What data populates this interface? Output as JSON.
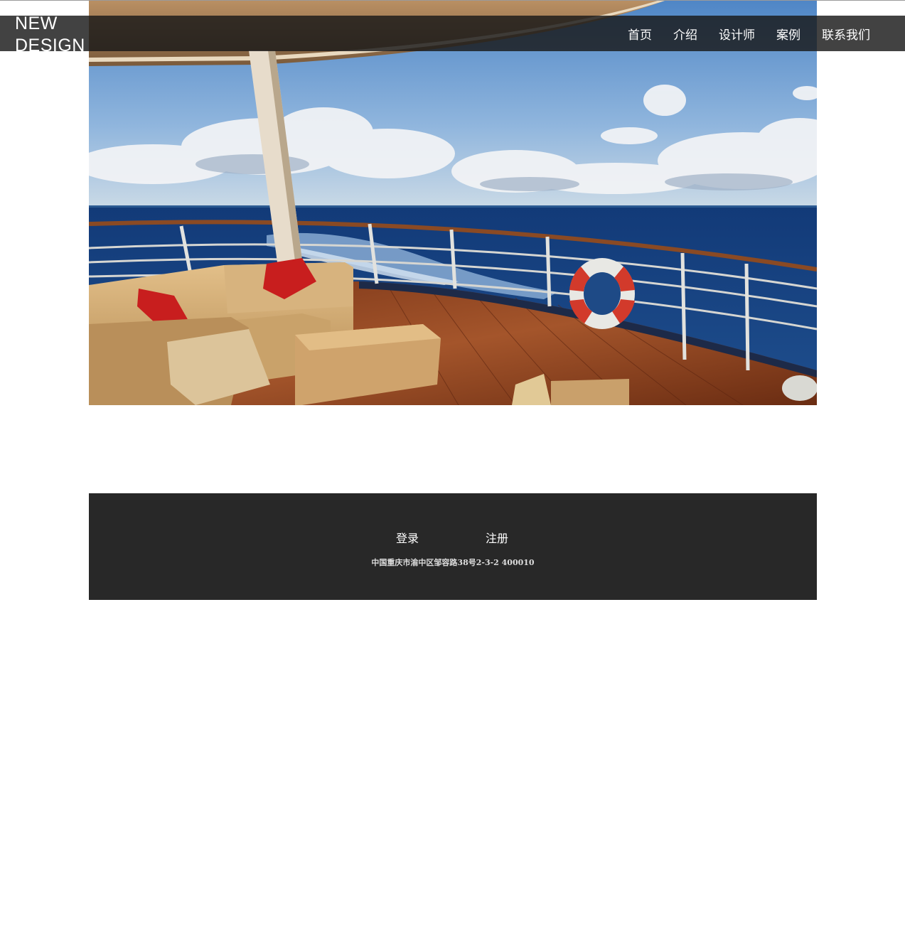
{
  "brand": {
    "line1": "NEW",
    "line2": "DESIGN"
  },
  "nav": {
    "items": [
      {
        "label": "首页"
      },
      {
        "label": "介绍"
      },
      {
        "label": "设计师"
      },
      {
        "label": "案例"
      },
      {
        "label": "联系我们"
      }
    ]
  },
  "footer": {
    "login_label": "登录",
    "register_label": "注册",
    "address": "中国重庆市渝中区邹容路38号2-3-2 400010"
  },
  "colors": {
    "nav_background": "#181818",
    "footer_background": "#282828",
    "text": "#ffffff"
  }
}
